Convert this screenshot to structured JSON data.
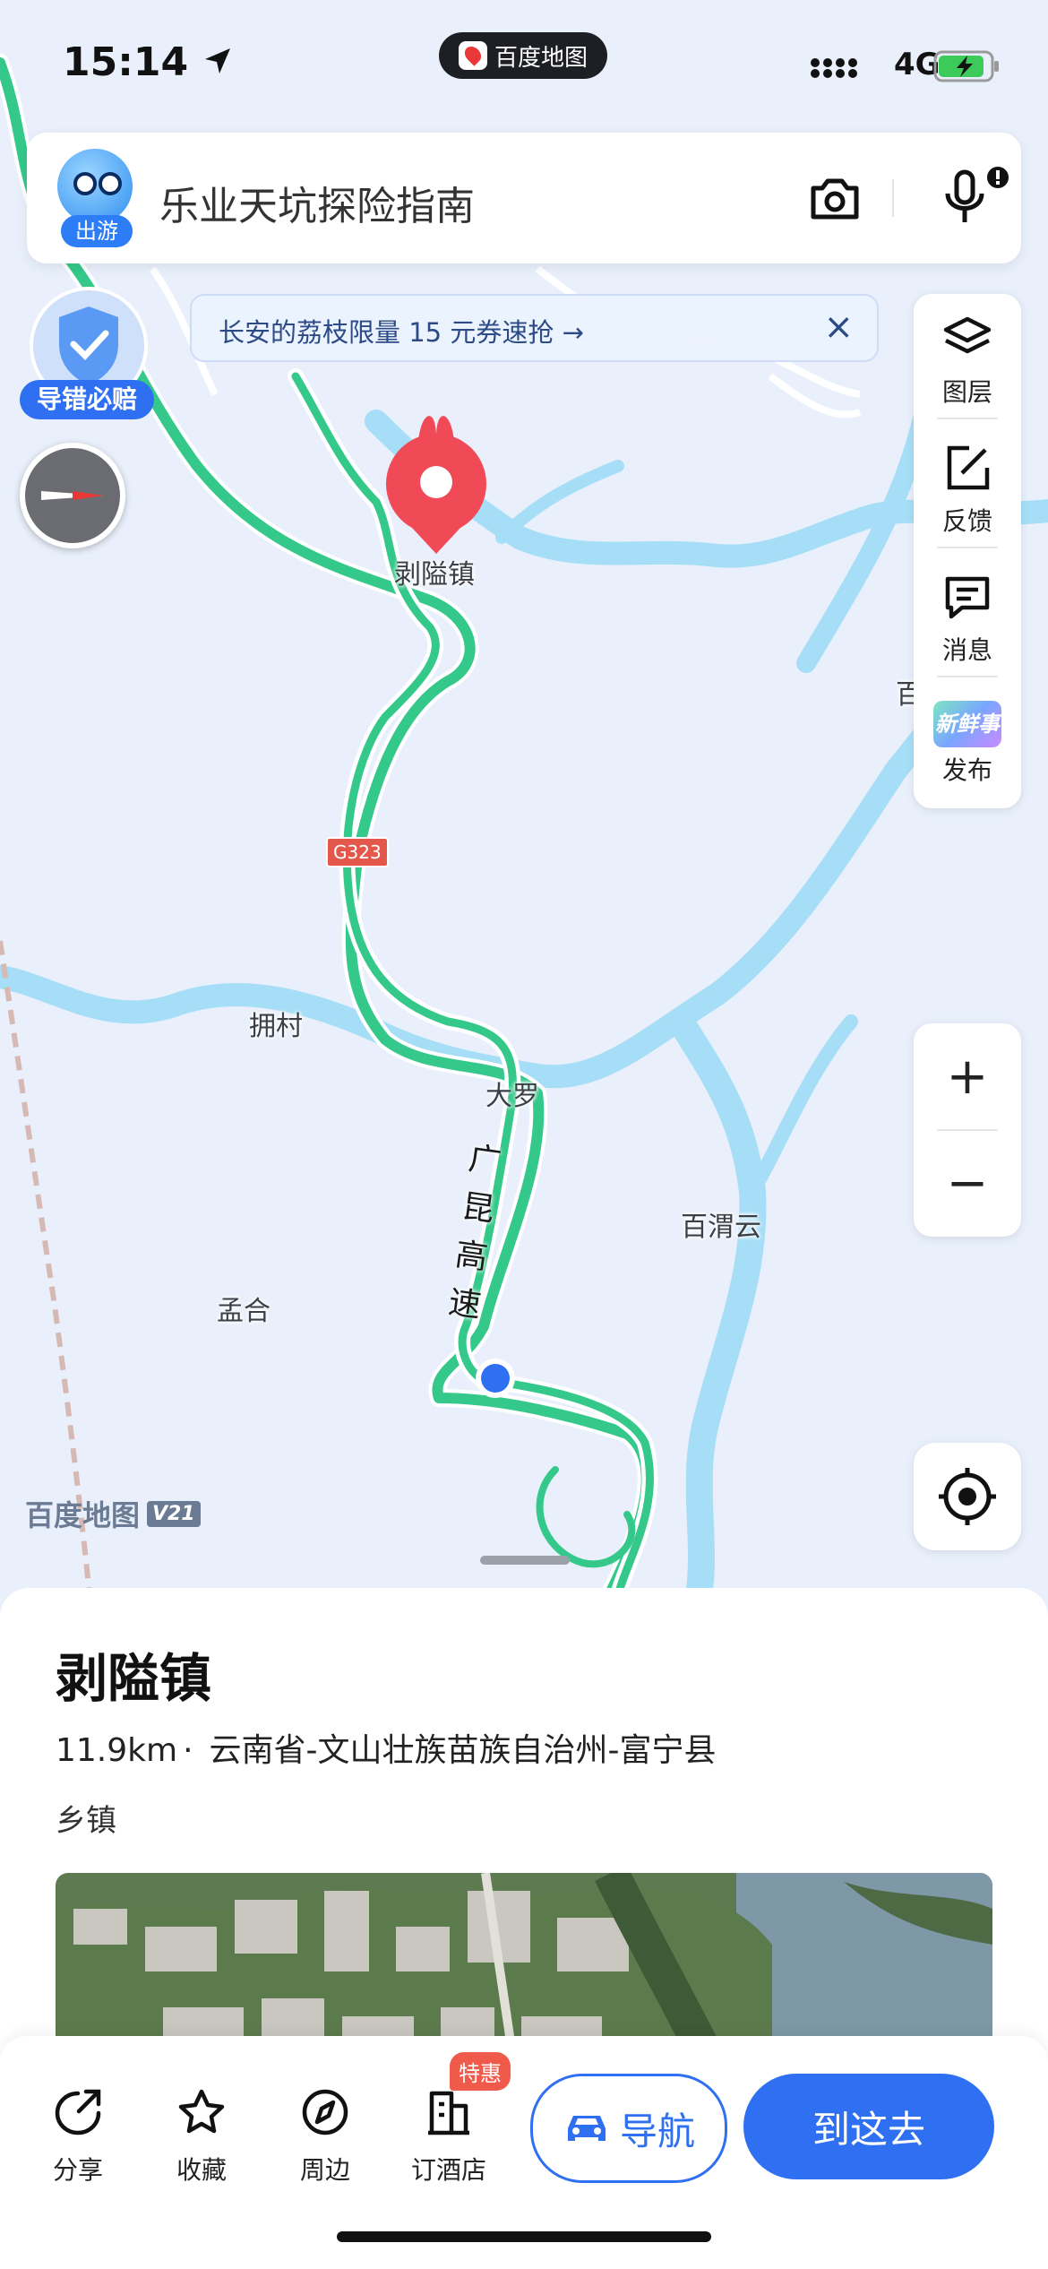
{
  "status_bar": {
    "time": "15:14",
    "app_pill": "百度地图",
    "network": "4G"
  },
  "search": {
    "avatar_tag": "出游",
    "query": "乐业天坑探险指南"
  },
  "banner": {
    "text": "长安的荔枝限量 15 元券速抢 →",
    "close": "×"
  },
  "guarantee": {
    "label": "导错必赔"
  },
  "toolbar": [
    {
      "name": "layers-icon",
      "label": "图层"
    },
    {
      "name": "feedback-icon",
      "label": "反馈"
    },
    {
      "name": "message-icon",
      "label": "消息"
    },
    {
      "name": "publish-icon",
      "label": "发布",
      "badge_text": "新鲜事"
    }
  ],
  "zoom": {
    "in": "+",
    "out": "−"
  },
  "map": {
    "pin_label": "剥隘镇",
    "labels": [
      "拥村",
      "大罗",
      "百渭云",
      "孟合",
      "百"
    ],
    "highway": "广昆高速",
    "road_shields": [
      "G323"
    ],
    "watermark": "百度地图",
    "watermark_version": "V21",
    "colors": {
      "road": "#34c98a",
      "water": "#a7def7",
      "land": "#e9f0fb",
      "pin": "#f04a56",
      "accent": "#2f6ff2"
    }
  },
  "place": {
    "title": "剥隘镇",
    "distance": "11.9km",
    "dot": "·",
    "region": "云南省-文山壮族苗族自治州-富宁县",
    "category": "乡镇"
  },
  "actions": [
    {
      "name": "share",
      "label": "分享",
      "icon": "share-icon"
    },
    {
      "name": "favorite",
      "label": "收藏",
      "icon": "star-icon"
    },
    {
      "name": "nearby",
      "label": "周边",
      "icon": "compass-icon"
    },
    {
      "name": "hotel",
      "label": "订酒店",
      "icon": "hotel-icon"
    }
  ],
  "hotel_badge": "特惠",
  "nav_button": "导航",
  "go_button": "到这去"
}
